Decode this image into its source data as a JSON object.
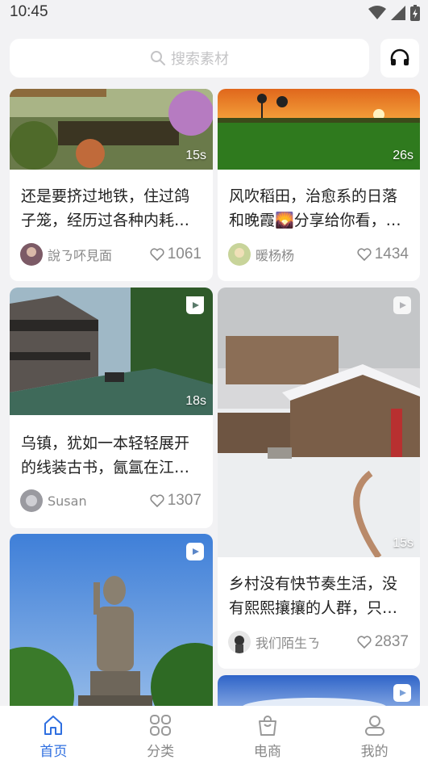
{
  "status_bar": {
    "time": "10:45"
  },
  "search": {
    "placeholder": "搜索素材",
    "icon": "search-icon"
  },
  "service_icon": "headset-icon",
  "feed": [
    {
      "title": "还是要挤过地铁，住过鸽子笼，经历过各种内耗…",
      "duration": "15s",
      "author": "說ㄋ吥見面",
      "likes": "1061"
    },
    {
      "title": "风吹稻田，治愈系的日落和晚霞🌄分享给你看，…",
      "duration": "26s",
      "author": "暖杨杨",
      "likes": "1434"
    },
    {
      "title": "乌镇，犹如一本轻轻展开的线装古书，氤氲在江…",
      "duration": "18s",
      "author": "Susan",
      "likes": "1307"
    },
    {
      "title": "乡村没有快节奏生活，没有熙熙攘攘的人群，只…",
      "duration": "15s",
      "author": "我们陌生ㄋ",
      "likes": "2837"
    }
  ],
  "tabs": [
    {
      "label": "首页",
      "icon": "home-icon",
      "active": true
    },
    {
      "label": "分类",
      "icon": "grid-icon",
      "active": false
    },
    {
      "label": "电商",
      "icon": "shopping-bag-icon",
      "active": false
    },
    {
      "label": "我的",
      "icon": "profile-icon",
      "active": false
    }
  ],
  "colors": {
    "accent": "#2f6fe0",
    "background": "#f2f2f4"
  }
}
